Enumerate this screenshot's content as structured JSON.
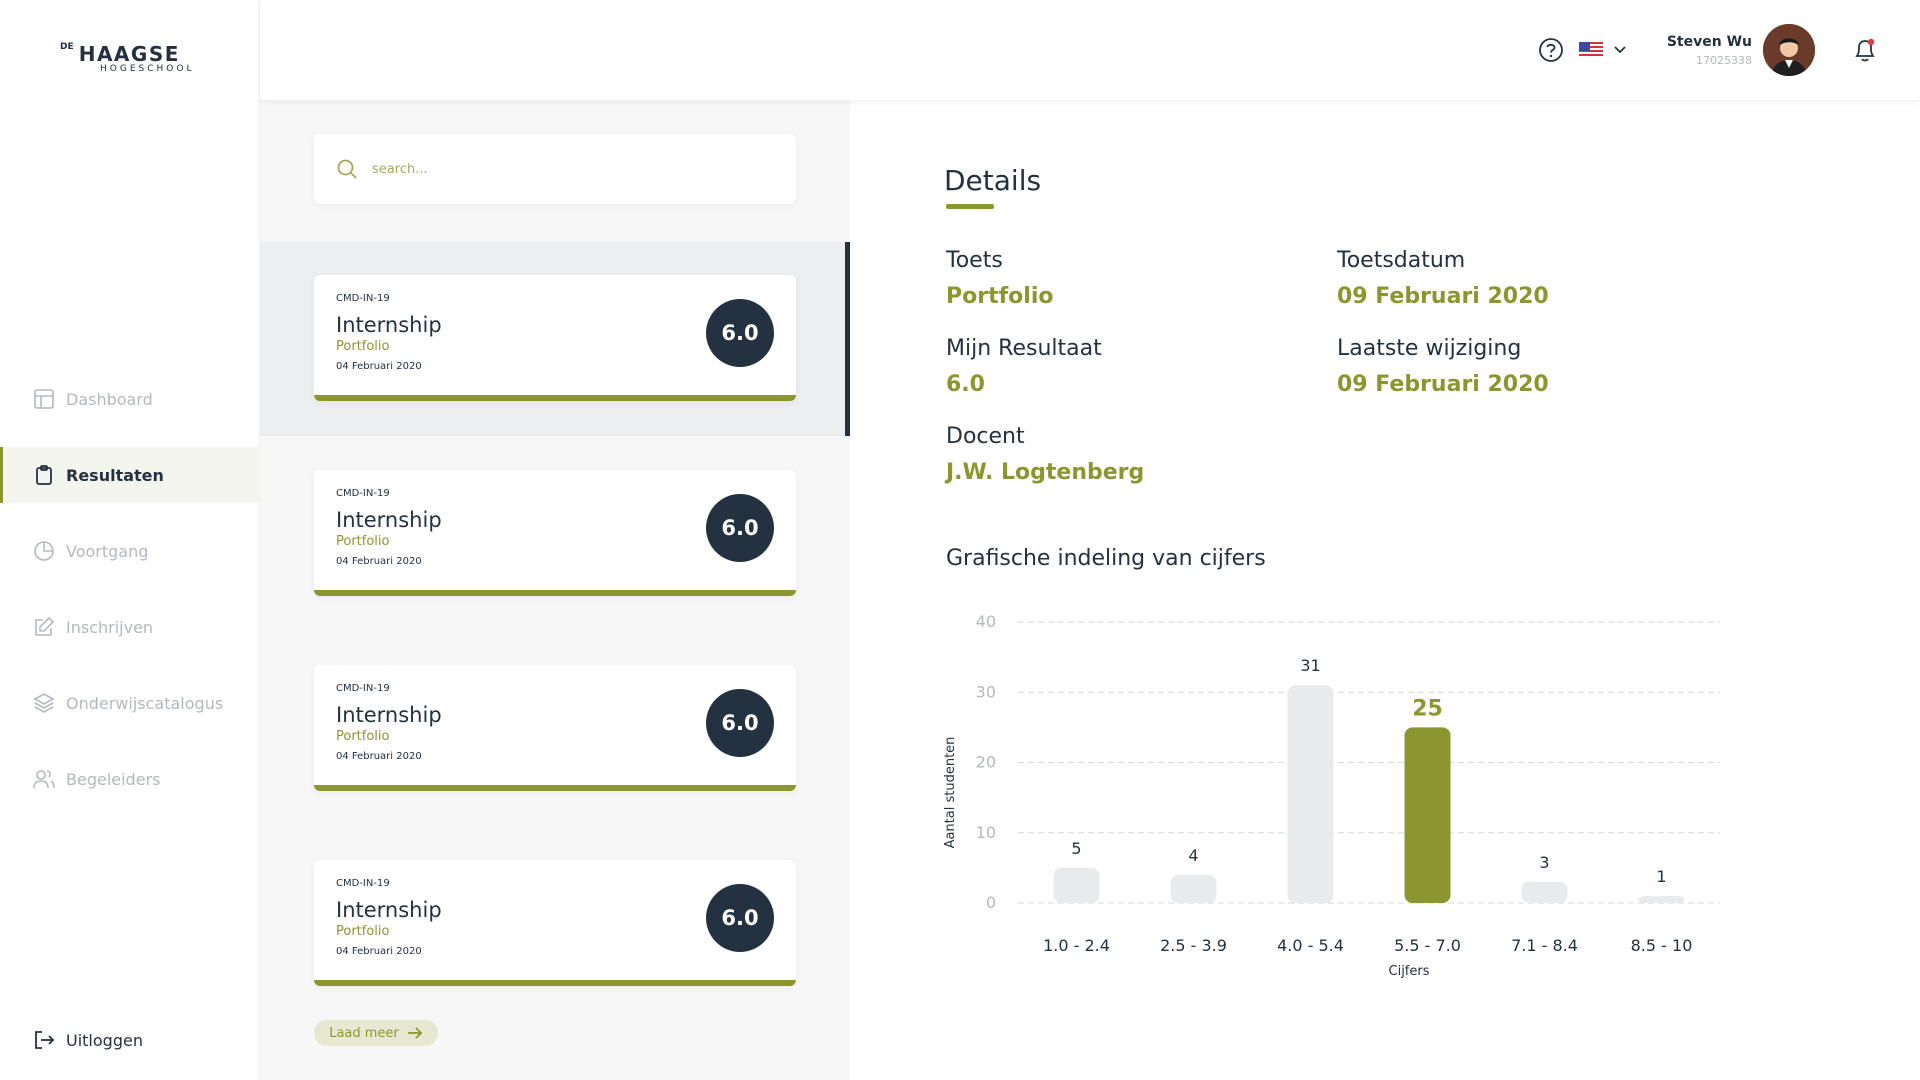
{
  "brand": {
    "de": "DE",
    "name": "HAAGSE",
    "sub": "HOGESCHOOL"
  },
  "sidebar": {
    "items": [
      {
        "label": "Dashboard",
        "icon": "dashboard-icon",
        "active": false
      },
      {
        "label": "Resultaten",
        "icon": "clipboard-icon",
        "active": true
      },
      {
        "label": "Voortgang",
        "icon": "pie-chart-icon",
        "active": false
      },
      {
        "label": "Inschrijven",
        "icon": "edit-icon",
        "active": false
      },
      {
        "label": "Onderwijscatalogus",
        "icon": "layers-icon",
        "active": false
      },
      {
        "label": "Begeleiders",
        "icon": "users-icon",
        "active": false
      }
    ],
    "logout_label": "Uitloggen"
  },
  "header": {
    "user_name": "Steven Wu",
    "user_id": "17025338"
  },
  "search": {
    "placeholder": "search..."
  },
  "results": [
    {
      "code": "CMD-IN-19",
      "title": "Internship",
      "subtitle": "Portfolio",
      "date": "04 Februari 2020",
      "grade": "6.0"
    },
    {
      "code": "CMD-IN-19",
      "title": "Internship",
      "subtitle": "Portfolio",
      "date": "04 Februari 2020",
      "grade": "6.0"
    },
    {
      "code": "CMD-IN-19",
      "title": "Internship",
      "subtitle": "Portfolio",
      "date": "04 Februari 2020",
      "grade": "6.0"
    },
    {
      "code": "CMD-IN-19",
      "title": "Internship",
      "subtitle": "Portfolio",
      "date": "04 Februari 2020",
      "grade": "6.0"
    }
  ],
  "load_more_label": "Laad meer",
  "details": {
    "title": "Details",
    "toets_label": "Toets",
    "toets_value": "Portfolio",
    "toetsdatum_label": "Toetsdatum",
    "toetsdatum_value": "09 Februari 2020",
    "resultaat_label": "Mijn Resultaat",
    "resultaat_value": "6.0",
    "wijziging_label": "Laatste wijziging",
    "wijziging_value": "09 Februari 2020",
    "docent_label": "Docent",
    "docent_value": "J.W. Logtenberg",
    "chart_title": "Grafische indeling van cijfers"
  },
  "colors": {
    "accent": "#8c962f",
    "navy": "#233140",
    "bar_grey": "#e9eaec"
  },
  "chart_data": {
    "type": "bar",
    "title": "Grafische indeling van cijfers",
    "categories": [
      "1.0 - 2.4",
      "2.5 - 3.9",
      "4.0 - 5.4",
      "5.5 - 7.0",
      "7.1 - 8.4",
      "8.5 - 10"
    ],
    "values": [
      5,
      4,
      31,
      25,
      3,
      1
    ],
    "highlight_index": 3,
    "xlabel": "Cijfers",
    "ylabel": "Aantal studenten",
    "ylim": [
      0,
      40
    ],
    "yticks": [
      0,
      10,
      20,
      30,
      40
    ],
    "grid": true
  }
}
